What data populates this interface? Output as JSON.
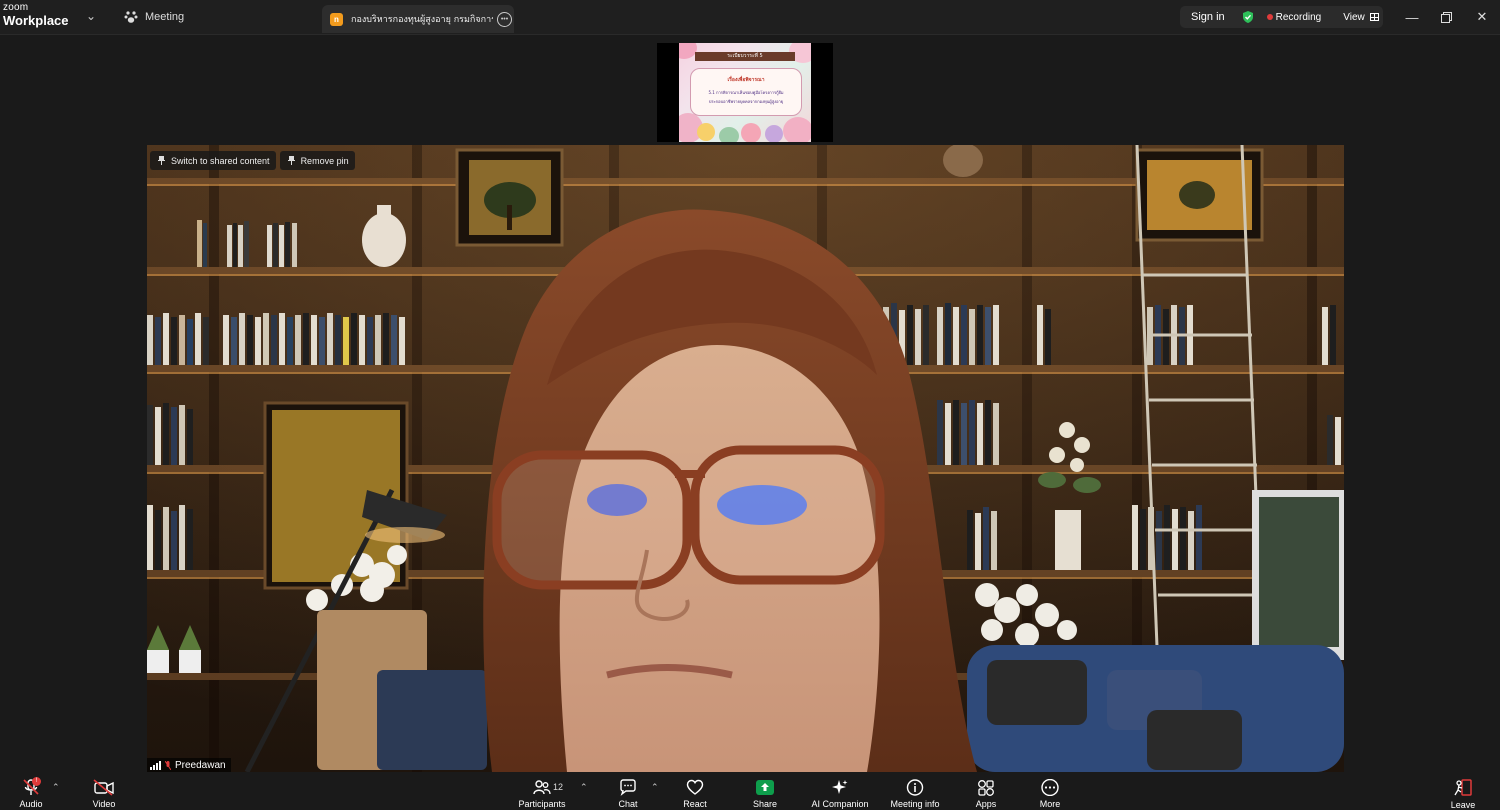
{
  "titlebar": {
    "brand_small": "zoom",
    "brand_big": "Workplace",
    "meeting_label": "Meeting",
    "tab_title": "กองบริหารกองทุนผู้สูงอายุ กรมกิจการผู้",
    "sign_in": "Sign in",
    "recording": "Recording",
    "view": "View",
    "record_color": "#e03b3b",
    "shield_color": "#2ec05a"
  },
  "slide": {
    "header": "ระเบียบวาระที่ 5",
    "line1": "เรื่องเพื่อพิจารณา",
    "line2": "5.1 การพิจารณาเห็นชอบคู่มือโครงการกู้ยืม",
    "line3": "ประกอบอาชีพรายบุคคลจากกองทุนผู้สูงอายุ"
  },
  "video": {
    "switch_label": "Switch to shared content",
    "remove_pin_label": "Remove pin",
    "participant_name": "Preedawan"
  },
  "toolbar": {
    "audio": "Audio",
    "video": "Video",
    "participants": "Participants",
    "participant_count": "12",
    "chat": "Chat",
    "react": "React",
    "share": "Share",
    "ai_companion": "AI Companion",
    "meeting_info": "Meeting info",
    "apps": "Apps",
    "more": "More",
    "leave": "Leave",
    "share_color": "#0e9e4c",
    "leave_color": "#e03b3b"
  }
}
